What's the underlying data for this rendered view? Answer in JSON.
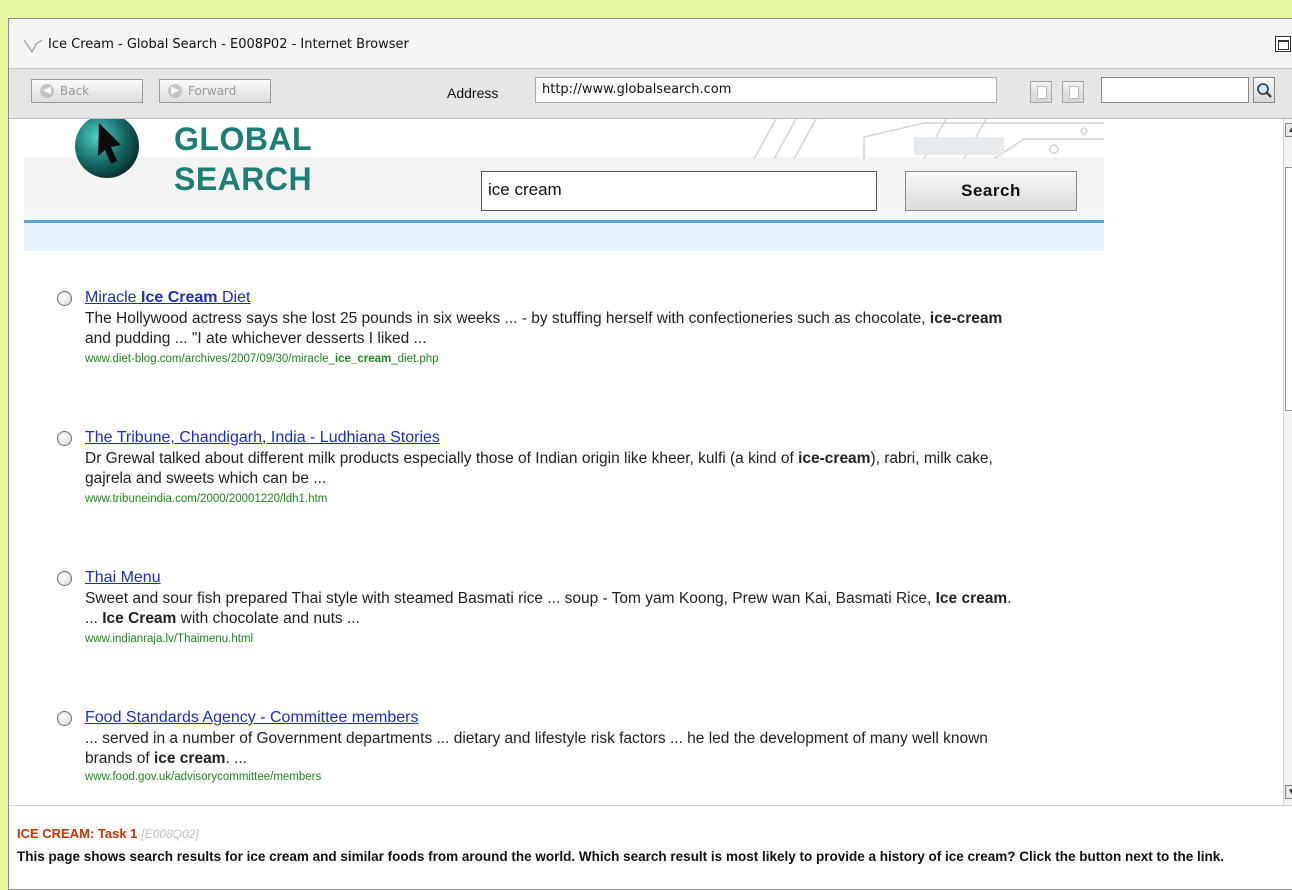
{
  "window": {
    "title": "Ice Cream - Global Search - E008P02 - Internet Browser"
  },
  "toolbar": {
    "back_label": "Back",
    "forward_label": "Forward",
    "address_label": "Address",
    "address_value": "http://www.globalsearch.com",
    "search_value": ""
  },
  "site": {
    "name_line1": "GLOBAL",
    "name_line2": "SEARCH",
    "query": "ice cream",
    "search_button": "Search"
  },
  "results": [
    {
      "title_parts": [
        "Miracle ",
        "Ice Cream",
        " Diet"
      ],
      "snippet_html": "The Hollywood actress says she lost 25 pounds in six weeks ... - by stuffing herself with confectioneries such as chocolate, <b>ice-cream</b> and pudding ... \"I ate whichever desserts I liked ...",
      "url_parts": [
        "www.diet-blog.com/archives/2007/09/30/miracle_",
        "ice_cream",
        "_diet.php"
      ]
    },
    {
      "title_parts": [
        "The Tribune, Chandigarh, India - Ludhiana Stories"
      ],
      "snippet_html": "Dr Grewal talked about different milk products especially those of Indian origin like kheer, kulfi (a kind of <b>ice-cream</b>), rabri, milk cake, gajrela and sweets which can be ...",
      "url_parts": [
        "www.tribuneindia.com/2000/20001220/ldh1.htm"
      ]
    },
    {
      "title_parts": [
        "Thai Menu"
      ],
      "snippet_html": "Sweet and sour fish prepared Thai style with steamed Basmati rice ... soup - Tom yam Koong, Prew wan Kai, Basmati Rice, <b>Ice cream</b>. ... <b>Ice Cream</b> with chocolate and nuts ...",
      "url_parts": [
        "www.indianraja.lv/Thaimenu.html"
      ]
    },
    {
      "title_parts": [
        "Food Standards Agency - Committee members"
      ],
      "snippet_html": "... served in a number of Government departments ... dietary and lifestyle risk factors ... he led the development of many well known brands of <b>ice cream</b>. ...",
      "url_parts": [
        "www.food.gov.uk/advisorycommittee/members"
      ]
    }
  ],
  "task": {
    "heading": "ICE CREAM: Task 1",
    "code": "[E008Q02]",
    "text": "This page shows search results for ice cream and similar foods from around the world. Which search result is most likely to provide a history of ice cream? Click the button next to the link."
  },
  "colors": {
    "page_background": "#e4f8a0",
    "site_name": "#1d7e74",
    "link": "#1a2ec9",
    "url": "#1d8a1d",
    "task_heading": "#cc3300"
  }
}
